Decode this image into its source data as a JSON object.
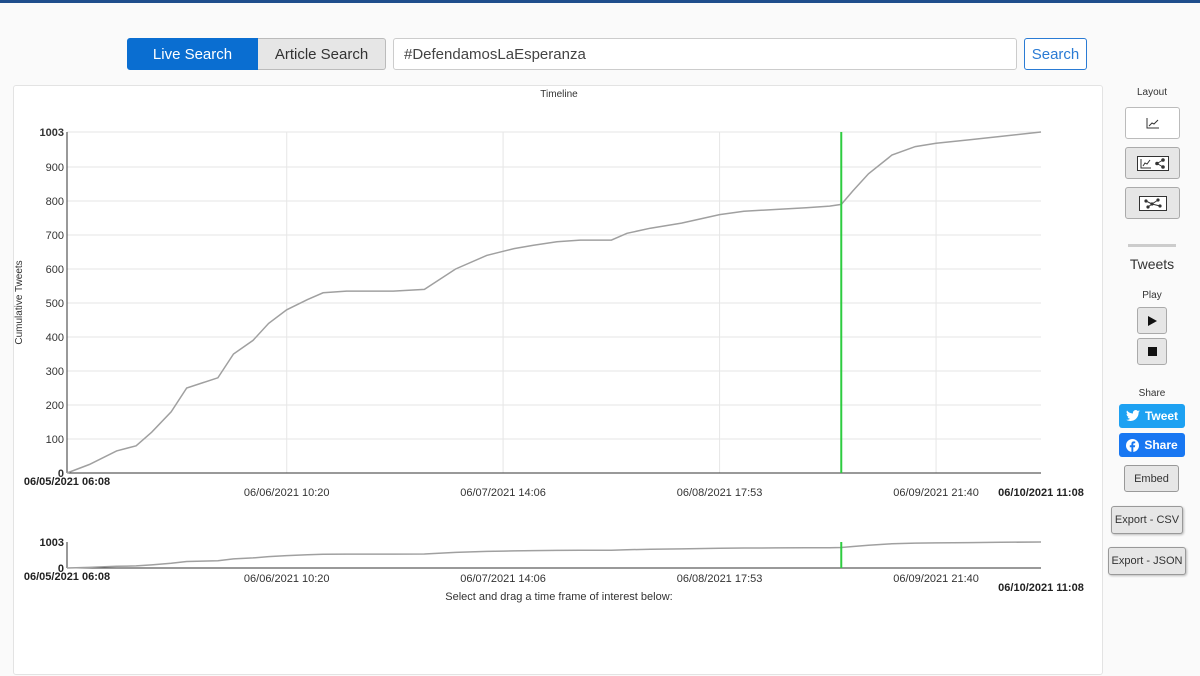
{
  "search": {
    "modes": [
      "Live Search",
      "Article Search"
    ],
    "query": "#DefendamosLaEsperanza",
    "button_label": "Search"
  },
  "timeline": {
    "title": "Timeline",
    "brush_hint": "Select and drag a time frame of interest below:"
  },
  "sidebar": {
    "layout_label": "Layout",
    "tweets_label": "Tweets",
    "play_label": "Play",
    "share_label": "Share",
    "tweet_button": "Tweet",
    "facebook_button": "Share",
    "embed_button": "Embed",
    "export_csv": "Export - CSV",
    "export_json": "Export - JSON"
  },
  "colors": {
    "accent": "#0a6ed1",
    "line": "#a0a0a0",
    "marker": "#2ecc40",
    "twitter": "#1da1f2",
    "facebook": "#1877f2"
  },
  "chart_data": {
    "type": "line",
    "title": "Timeline",
    "ylabel": "Cumulative Tweets",
    "xlabel": "",
    "ylim": [
      0,
      1003
    ],
    "yticks": [
      0,
      100,
      200,
      300,
      400,
      500,
      600,
      700,
      800,
      900,
      1003
    ],
    "x_start": "06/05/2021 06:08",
    "x_end": "06/10/2021 11:08",
    "xticks": [
      "06/06/2021 10:20",
      "06/07/2021 14:06",
      "06/08/2021 17:53",
      "06/09/2021 21:40"
    ],
    "marker_time": "06/09/2021 09:30",
    "grid": true,
    "series": [
      {
        "x": [
          "06/05/2021 06:08",
          "06/05/2021 09:00",
          "06/05/2021 12:30",
          "06/05/2021 15:00",
          "06/05/2021 17:00",
          "06/05/2021 19:30",
          "06/05/2021 21:30",
          "06/05/2021 23:30",
          "06/06/2021 01:30",
          "06/06/2021 03:30",
          "06/06/2021 06:00",
          "06/06/2021 08:00",
          "06/06/2021 10:20",
          "06/06/2021 13:00",
          "06/06/2021 15:00",
          "06/06/2021 18:00",
          "06/06/2021 21:00",
          "06/07/2021 00:00",
          "06/07/2021 04:00",
          "06/07/2021 08:00",
          "06/07/2021 12:00",
          "06/07/2021 14:06",
          "06/07/2021 15:30",
          "06/07/2021 18:00",
          "06/07/2021 21:00",
          "06/08/2021 00:00",
          "06/08/2021 04:00",
          "06/08/2021 06:00",
          "06/08/2021 09:00",
          "06/08/2021 13:00",
          "06/08/2021 17:53",
          "06/08/2021 21:00",
          "06/09/2021 01:00",
          "06/09/2021 05:00",
          "06/09/2021 08:00",
          "06/09/2021 09:30",
          "06/09/2021 11:00",
          "06/09/2021 13:00",
          "06/09/2021 16:00",
          "06/09/2021 19:00",
          "06/09/2021 21:40",
          "06/10/2021 02:00",
          "06/10/2021 06:00",
          "06/10/2021 11:08"
        ],
        "y": [
          0,
          25,
          65,
          80,
          120,
          180,
          250,
          265,
          280,
          350,
          390,
          440,
          480,
          510,
          530,
          535,
          535,
          535,
          540,
          600,
          640,
          652,
          660,
          670,
          680,
          685,
          685,
          705,
          720,
          735,
          760,
          770,
          775,
          780,
          785,
          790,
          830,
          880,
          935,
          960,
          970,
          980,
          990,
          1003
        ]
      }
    ]
  }
}
